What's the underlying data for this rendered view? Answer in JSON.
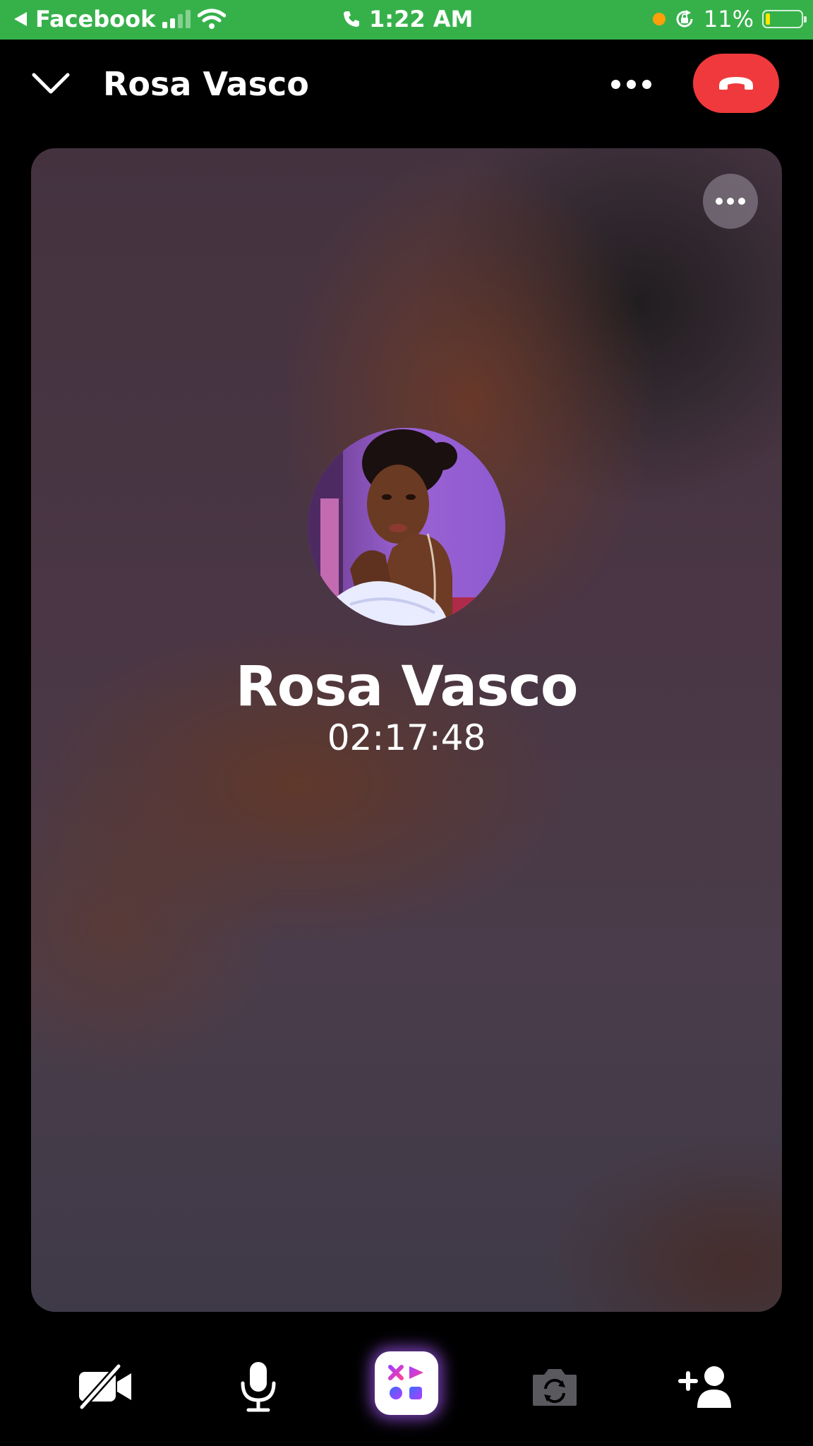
{
  "status_bar": {
    "back_app": "Facebook",
    "time": "1:22 AM",
    "battery": "11%",
    "battery_level": 0.11,
    "signal_bars": 2,
    "accent_color": "#36b14a"
  },
  "header": {
    "title": "Rosa Vasco",
    "collapse_icon": "chevron-down-icon",
    "more_icon": "more-horizontal-icon",
    "end_call_icon": "end-call-icon",
    "end_call_color": "#f0393c"
  },
  "call": {
    "contact_name": "Rosa Vasco",
    "duration": "02:17:48",
    "tile_more_icon": "more-horizontal-icon",
    "avatar_icon": "profile-photo"
  },
  "controls": {
    "items": [
      {
        "icon": "video-off-icon"
      },
      {
        "icon": "microphone-icon"
      },
      {
        "icon": "effects-icon"
      },
      {
        "icon": "flip-camera-icon",
        "disabled": true
      },
      {
        "icon": "add-person-icon"
      }
    ]
  }
}
